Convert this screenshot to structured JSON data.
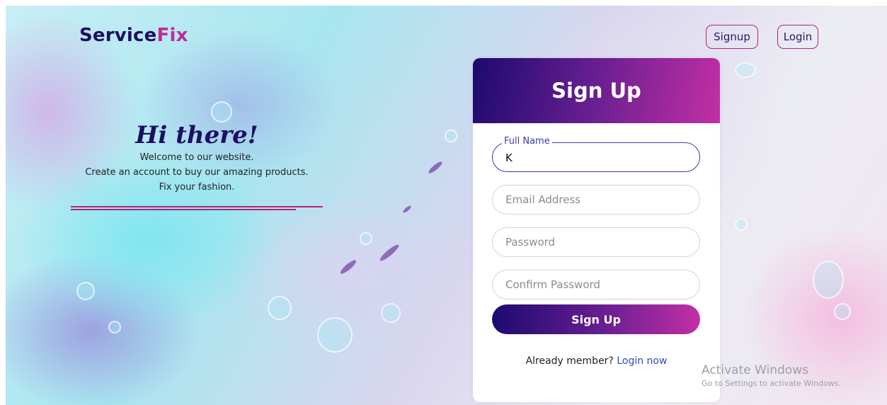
{
  "brand": {
    "part1": "Service",
    "part2": "Fix"
  },
  "nav": {
    "signup_label": "Signup",
    "login_label": "Login"
  },
  "hero": {
    "heading": "Hi there!",
    "line1": "Welcome to our website.",
    "line2": "Create an account to buy our amazing products.",
    "line3": "Fix your fashion."
  },
  "form": {
    "title": "Sign Up",
    "full_name": {
      "label": "Full Name",
      "value": "K"
    },
    "email": {
      "placeholder": "Email Address",
      "value": ""
    },
    "password": {
      "placeholder": "Password",
      "value": ""
    },
    "confirm_password": {
      "placeholder": "Confirm Password",
      "value": ""
    },
    "submit_label": "Sign Up",
    "footer_text": "Already member?",
    "footer_link": "Login now"
  },
  "watermark": {
    "title": "Activate Windows",
    "subtitle": "Go to Settings to activate Windows."
  },
  "colors": {
    "brand_dark": "#1d0f63",
    "brand_accent": "#c22a9a",
    "gradient_start": "#1d0a6e",
    "gradient_end": "#c32fa4",
    "link": "#2f4fb5"
  }
}
